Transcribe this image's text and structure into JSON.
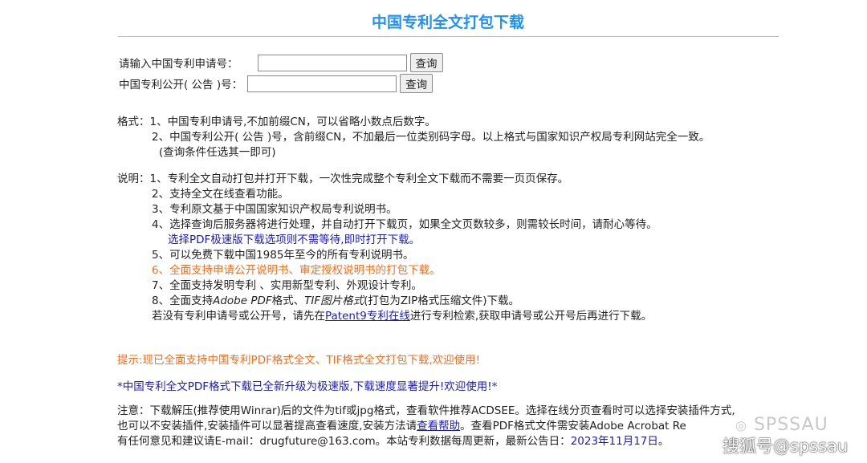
{
  "header": {
    "title": "中国专利全文打包下载"
  },
  "search": {
    "app_no_label": "请输入中国专利申请号：",
    "pub_no_label": "中国专利公开( 公告 )号：",
    "query_button": "查询",
    "app_no_value": "",
    "pub_no_value": ""
  },
  "format": {
    "prefix": "格式：",
    "lines": [
      "1、中国专利申请号,不加前缀CN，可以省略小数点后数字。",
      "2、中国专利公开( 公告 )号，含前缀CN，不加最后一位类别码字母。以上格式与国家知识产权局专利网站完全一致。",
      "(查询条件任选其一即可)"
    ]
  },
  "notes": {
    "prefix": "说明：",
    "l1": "1、专利全文自动打包并打开下载，一次性完成整个专利全文下载而不需要一页页保存。",
    "l2": "2、支持全文在线查看功能。",
    "l3": "3、专利原文基于中国国家知识产权局专利说明书。",
    "l4": "4、选择查询后服务器将进行处理，并自动打开下载页，如果全文页数较多，则需较长时间，请耐心等待。",
    "l4b": "选择PDF极速版下载选项则不需等待,即时打开下载。",
    "l5": "5、可以免费下载中国1985年至今的所有专利说明书。",
    "l6": "6、全面支持申请公开说明书、审定授权说明书的打包下载。",
    "l7": "7、全面支持发明专利 、实用新型专利、外观设计专利。",
    "l8_a": "8、全面支持",
    "l8_b": "Adobe PDF",
    "l8_c": "格式、",
    "l8_d": "TIF图片格式",
    "l8_e": "(打包为ZIP格式压缩文件)下载。",
    "l9_a": "若没有专利申请号或公开号，请先在",
    "l9_link": "Patent9专利在线",
    "l9_b": "进行专利检索,获取申请号或公开号后再进行下载。"
  },
  "tip": "提示:现已全面支持中国专利PDF格式全文、TIF格式全文打包下载,欢迎使用!",
  "announcement": "*中国专利全文PDF格式下载已全新升级为极速版,下载速度显著提升!欢迎使用!*",
  "footer": {
    "l1": "注意：下载解压(推荐使用Winrar)后的文件为tif或jpg格式，查看软件推荐ACDSEE。选择在线分页查看时可以选择安装插件方式,",
    "l2_a": "也可以不安装插件,安装插件可以显著提高查看速度,安装方法请",
    "l2_link": "查看帮助",
    "l2_b": "。查看PDF格式文件需安装Adobe Acrobat Re",
    "l3_a": "有任何意见和建议请E-mail：drugfuture@163.com。本站专利数据每周更新，最新公告日：",
    "l3_date": "2023年11月17日",
    "l3_b": "。"
  },
  "watermarks": {
    "brand": "SPSSAU",
    "sohu": "搜狐号@spssau"
  },
  "colors": {
    "title": "#1e90ff",
    "link": "#1a1acd",
    "orange": "#ff6a1a"
  }
}
